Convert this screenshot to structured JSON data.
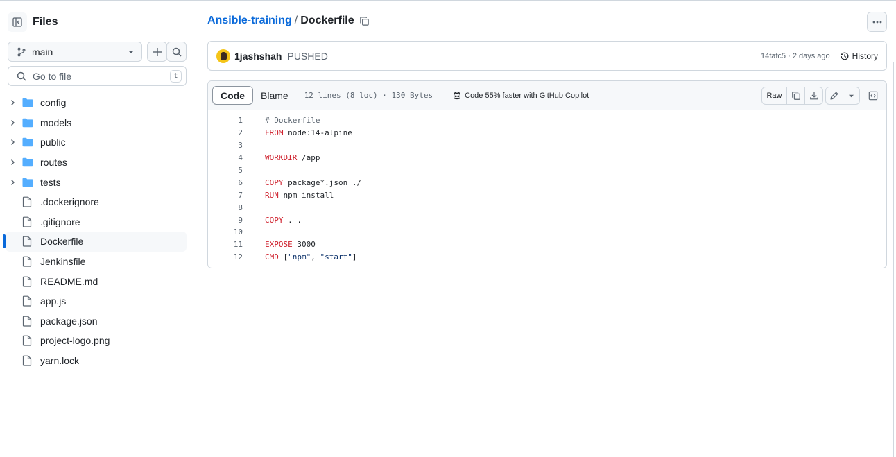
{
  "sidebar": {
    "title": "Files",
    "branch": "main",
    "search_placeholder": "Go to file",
    "search_shortcut": "t",
    "items": [
      {
        "name": "config",
        "type": "folder"
      },
      {
        "name": "models",
        "type": "folder"
      },
      {
        "name": "public",
        "type": "folder"
      },
      {
        "name": "routes",
        "type": "folder"
      },
      {
        "name": "tests",
        "type": "folder"
      },
      {
        "name": ".dockerignore",
        "type": "file"
      },
      {
        "name": ".gitignore",
        "type": "file"
      },
      {
        "name": "Dockerfile",
        "type": "file",
        "active": true
      },
      {
        "name": "Jenkinsfile",
        "type": "file"
      },
      {
        "name": "README.md",
        "type": "file"
      },
      {
        "name": "app.js",
        "type": "file"
      },
      {
        "name": "package.json",
        "type": "file"
      },
      {
        "name": "project-logo.png",
        "type": "file"
      },
      {
        "name": "yarn.lock",
        "type": "file"
      }
    ]
  },
  "breadcrumb": {
    "repo": "Ansible-training",
    "separator": "/",
    "file": "Dockerfile"
  },
  "commit": {
    "author": "1jashshah",
    "message": "PUSHED",
    "meta": "14fafc5 · 2 days ago",
    "history_label": "History"
  },
  "code_view": {
    "tab_code": "Code",
    "tab_blame": "Blame",
    "file_info": "12 lines (8 loc) · 130 Bytes",
    "copilot_text": "Code 55% faster with GitHub Copilot",
    "raw_label": "Raw",
    "lines": [
      [
        {
          "t": "# Dockerfile",
          "c": "cm"
        }
      ],
      [
        {
          "t": "FROM",
          "c": "kw"
        },
        {
          "t": " node:14-alpine",
          "c": ""
        }
      ],
      [],
      [
        {
          "t": "WORKDIR",
          "c": "kw"
        },
        {
          "t": " /app",
          "c": ""
        }
      ],
      [],
      [
        {
          "t": "COPY",
          "c": "kw"
        },
        {
          "t": " package*.json ./",
          "c": ""
        }
      ],
      [
        {
          "t": "RUN",
          "c": "kw"
        },
        {
          "t": " npm install",
          "c": ""
        }
      ],
      [],
      [
        {
          "t": "COPY",
          "c": "kw"
        },
        {
          "t": " . .",
          "c": ""
        }
      ],
      [],
      [
        {
          "t": "EXPOSE",
          "c": "kw"
        },
        {
          "t": " 3000",
          "c": ""
        }
      ],
      [
        {
          "t": "CMD",
          "c": "kw"
        },
        {
          "t": " [",
          "c": ""
        },
        {
          "t": "\"npm\"",
          "c": "str"
        },
        {
          "t": ", ",
          "c": ""
        },
        {
          "t": "\"start\"",
          "c": "str"
        },
        {
          "t": "]",
          "c": ""
        }
      ]
    ]
  },
  "colors": {
    "accent": "#0969da",
    "folder": "#54aeff",
    "keyword": "#cf222e",
    "string": "#0a3069"
  }
}
